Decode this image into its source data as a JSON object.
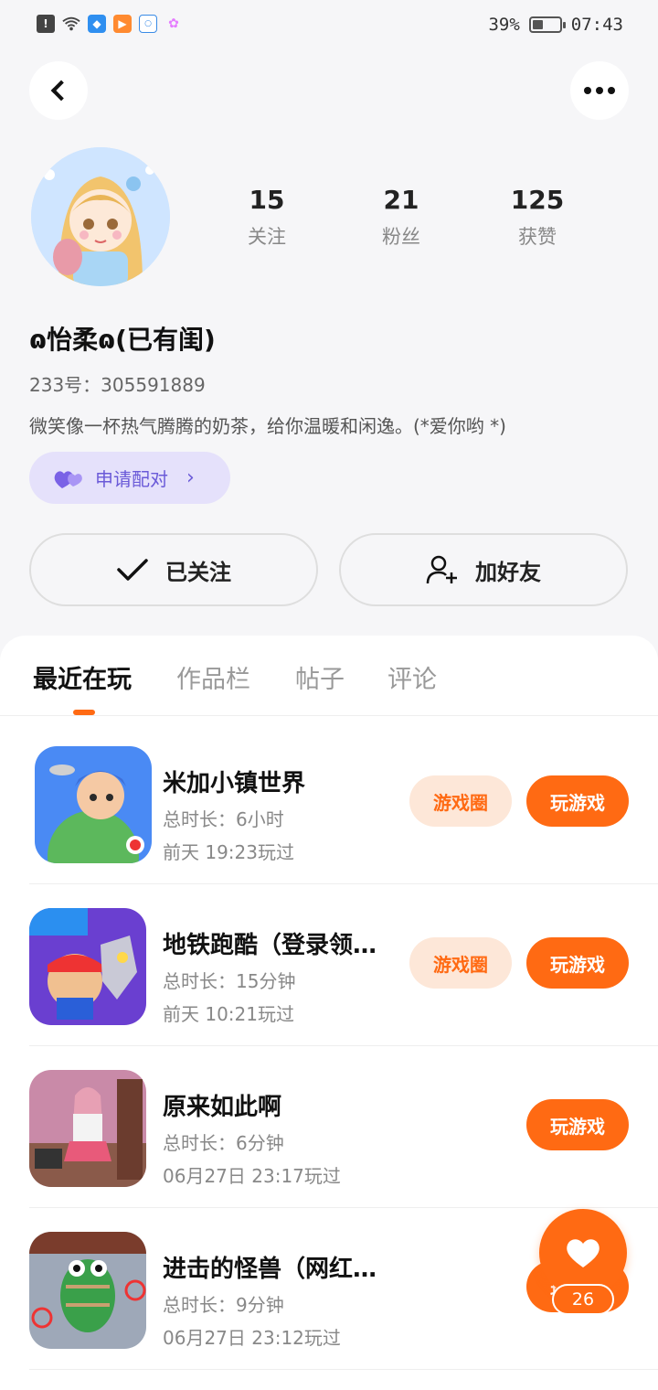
{
  "status_bar": {
    "battery_percent": "39%",
    "battery_level": 0.39,
    "time": "07:43",
    "icons": [
      "alert-icon",
      "wifi-icon",
      "app-notification-icon",
      "video-app-icon",
      "security-app-icon",
      "flower-app-icon"
    ]
  },
  "profile": {
    "stats": [
      {
        "value": "15",
        "label": "关注"
      },
      {
        "value": "21",
        "label": "粉丝"
      },
      {
        "value": "125",
        "label": "获赞"
      }
    ],
    "nickname": "ɷ怡柔ɷ(已有闺)",
    "uid": "233号：305591889",
    "bio": "微笑像一杯热气腾腾的奶茶，给你温暖和闲逸。(*爱你哟 *)",
    "pair_label": "申请配对",
    "follow_label": "已关注",
    "add_friend_label": "加好友"
  },
  "tabs": [
    "最近在玩",
    "作品栏",
    "帖子",
    "评论"
  ],
  "games": [
    {
      "title": "米加小镇世界",
      "duration": "总时长：6小时",
      "last_played": "前天 19:23玩过",
      "circle_label": "游戏圈",
      "play_label": "玩游戏",
      "has_circle": true
    },
    {
      "title": "地铁跑酷（登录领…",
      "duration": "总时长：15分钟",
      "last_played": "前天 10:21玩过",
      "circle_label": "游戏圈",
      "play_label": "玩游戏",
      "has_circle": true
    },
    {
      "title": "原来如此啊",
      "duration": "总时长：6分钟",
      "last_played": "06月27日 23:17玩过",
      "play_label": "玩游戏",
      "has_circle": false
    },
    {
      "title": "进击的怪兽（网红青蛙）",
      "duration": "总时长：9分钟",
      "last_played": "06月27日 23:12玩过",
      "play_label": "玩游戏",
      "has_circle": false
    }
  ],
  "like_count": "26",
  "colors": {
    "accent": "#ff6a13",
    "pair_bg": "#e5e1fb",
    "pair_fg": "#6a5ad8"
  }
}
